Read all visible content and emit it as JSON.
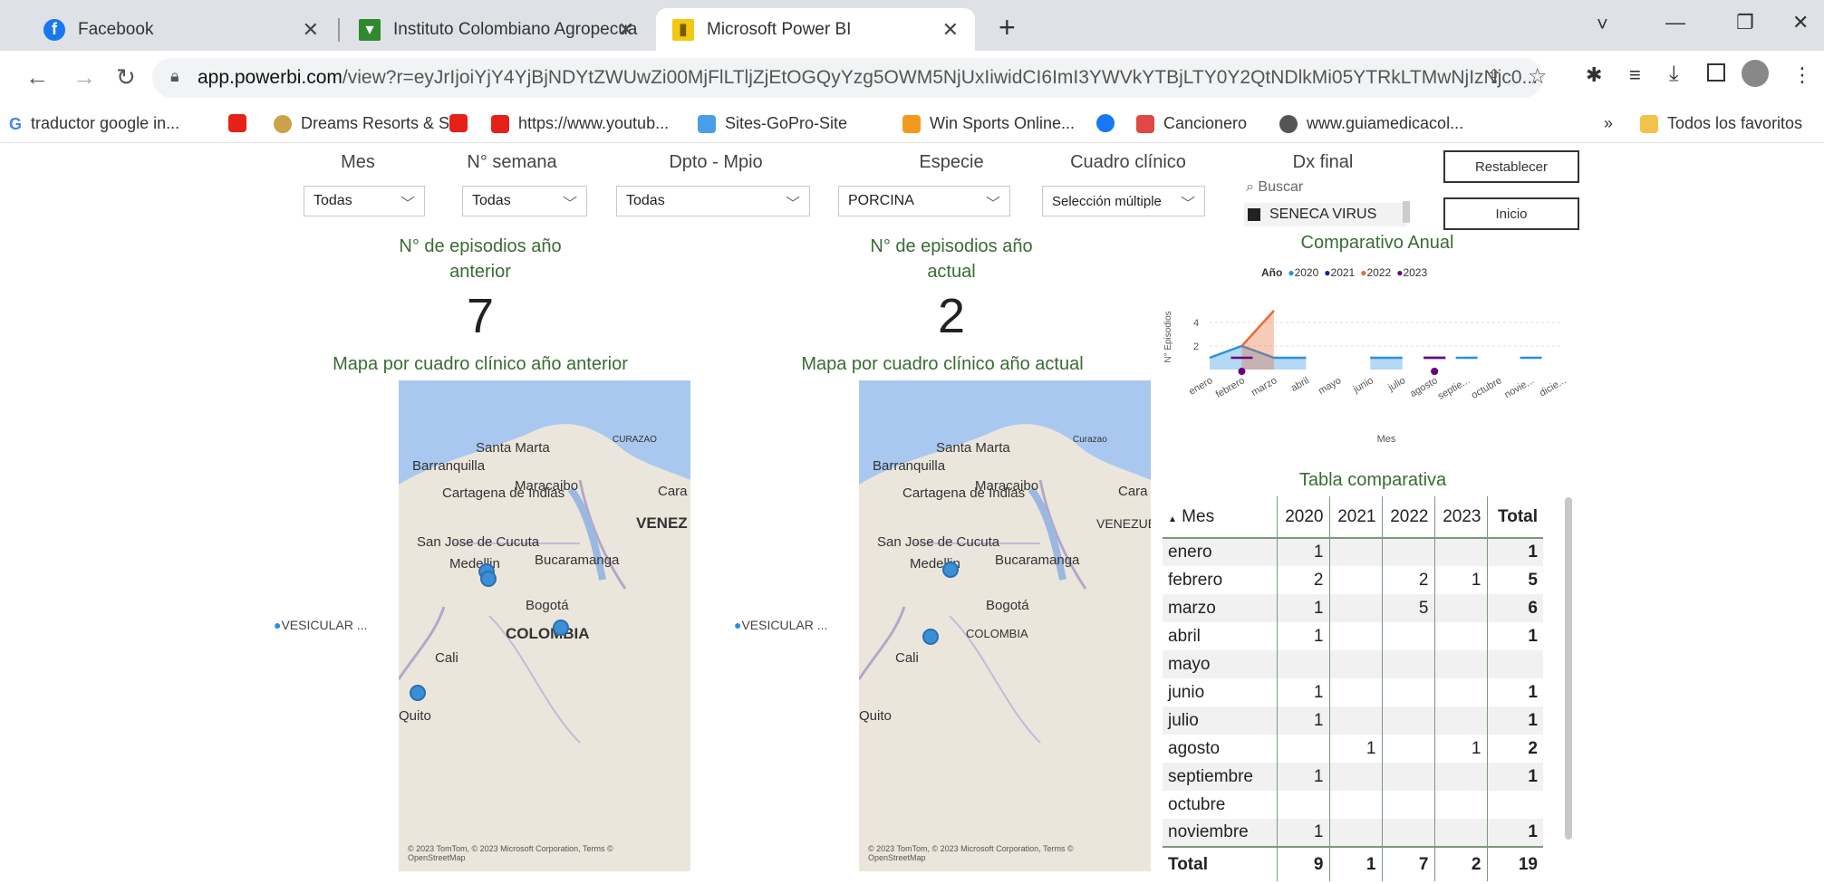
{
  "browser": {
    "tabs": [
      {
        "title": "Facebook"
      },
      {
        "title": "Instituto Colombiano Agropecua"
      },
      {
        "title": "Microsoft Power BI"
      }
    ],
    "new_tab": "+",
    "url_domain": "app.powerbi.com",
    "url_path": "/view?r=eyJrIjoiYjY4YjBjNDYtZWUwZi00MjFlLTljZjEtOGQyYzg5OWM5NjUxIiwidCI6ImI3YWVkYTBjLTY0Y2QtNDlkMi05YTRkLTMwNjIzNjc0...",
    "bookmarks": [
      "traductor google in...",
      "",
      "Dreams Resorts & S...",
      "",
      "https://www.youtub...",
      "Sites-GoPro-Site",
      "Win Sports Online...",
      "",
      "Cancionero",
      "www.guiamedicacol..."
    ],
    "bookmarks_overflow": "»",
    "all_bookmarks": "Todos los favoritos",
    "window_controls": [
      "˅",
      "—",
      "❐",
      "✕"
    ]
  },
  "filters": {
    "mes": {
      "label": "Mes",
      "value": "Todas"
    },
    "semana": {
      "label": "N° semana",
      "value": "Todas"
    },
    "dpto": {
      "label": "Dpto - Mpio",
      "value": "Todas"
    },
    "especie": {
      "label": "Especie",
      "value": "PORCINA"
    },
    "cuadro": {
      "label": "Cuadro clínico",
      "value": "Selección múltiple"
    },
    "dx": {
      "label": "Dx final",
      "search_placeholder": "Buscar",
      "selected": "SENECA VIRUS"
    }
  },
  "buttons": {
    "reset": "Restablecer",
    "home": "Inicio"
  },
  "kpi_prev": {
    "title_line1": "N° de episodios año",
    "title_line2": "anterior",
    "value": "7"
  },
  "kpi_curr": {
    "title_line1": "N° de episodios año",
    "title_line2": "actual",
    "value": "2"
  },
  "map_prev": {
    "title": "Mapa por cuadro clínico año anterior",
    "legend": "VESICULAR ...",
    "labels": [
      "Santa Marta",
      "Barranquilla",
      "Cartagena de Indias",
      "Maracaibo",
      "Cara",
      "VENEZ",
      "San Jose de Cucuta",
      "Medellin",
      "Bucaramanga",
      "Bogotá",
      "COLOMBIA",
      "Cali",
      "Quito",
      "CURAZAO"
    ],
    "credit": "© 2023 TomTom, © 2023 Microsoft Corporation, Terms © OpenStreetMap"
  },
  "map_curr": {
    "title": "Mapa por cuadro clínico año actual",
    "legend": "VESICULAR ...",
    "labels": [
      "Santa Marta",
      "Barranquilla",
      "Cartagena de Indias",
      "Maracaibo",
      "Cara",
      "VENEZUE",
      "San Jose de Cucuta",
      "Medellin",
      "Bucaramanga",
      "Bogotá",
      "COLOMBIA",
      "Cali",
      "Quito",
      "Curazao"
    ],
    "credit": "© 2023 TomTom, © 2023 Microsoft Corporation, Terms © OpenStreetMap"
  },
  "chart_data": {
    "type": "area",
    "title": "Comparativo Anual",
    "legend_title": "Año",
    "xlabel": "Mes",
    "ylabel": "N° Episodios",
    "categories": [
      "enero",
      "febrero",
      "marzo",
      "abril",
      "mayo",
      "junio",
      "julio",
      "agosto",
      "septie...",
      "octubre",
      "novie...",
      "dicie..."
    ],
    "yticks": [
      "2",
      "4"
    ],
    "ylim": [
      0,
      6
    ],
    "series": [
      {
        "name": "2020",
        "color": "#2b8fe0",
        "values": [
          1,
          2,
          1,
          1,
          null,
          1,
          1,
          null,
          1,
          null,
          1,
          null
        ]
      },
      {
        "name": "2021",
        "color": "#12239e",
        "values": [
          null,
          null,
          null,
          null,
          null,
          null,
          null,
          1,
          null,
          null,
          null,
          null
        ]
      },
      {
        "name": "2022",
        "color": "#e66c37",
        "values": [
          null,
          2,
          5,
          null,
          null,
          null,
          null,
          null,
          null,
          null,
          null,
          null
        ]
      },
      {
        "name": "2023",
        "color": "#6b007b",
        "values": [
          null,
          1,
          null,
          null,
          null,
          null,
          null,
          1,
          null,
          null,
          null,
          null
        ]
      }
    ]
  },
  "table": {
    "title": "Tabla comparativa",
    "headers": [
      "Mes",
      "2020",
      "2021",
      "2022",
      "2023",
      "Total"
    ],
    "rows": [
      [
        "enero",
        "1",
        "",
        "",
        "",
        "1"
      ],
      [
        "febrero",
        "2",
        "",
        "2",
        "1",
        "5"
      ],
      [
        "marzo",
        "1",
        "",
        "5",
        "",
        "6"
      ],
      [
        "abril",
        "1",
        "",
        "",
        "",
        "1"
      ],
      [
        "mayo",
        "",
        "",
        "",
        "",
        ""
      ],
      [
        "junio",
        "1",
        "",
        "",
        "",
        "1"
      ],
      [
        "julio",
        "1",
        "",
        "",
        "",
        "1"
      ],
      [
        "agosto",
        "",
        "1",
        "",
        "1",
        "2"
      ],
      [
        "septiembre",
        "1",
        "",
        "",
        "",
        "1"
      ],
      [
        "octubre",
        "",
        "",
        "",
        "",
        ""
      ],
      [
        "noviembre",
        "1",
        "",
        "",
        "",
        "1"
      ]
    ],
    "total": [
      "Total",
      "9",
      "1",
      "7",
      "2",
      "19"
    ]
  }
}
